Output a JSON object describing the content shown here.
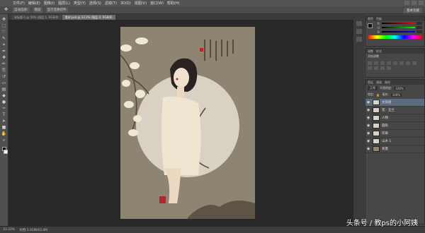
{
  "menu": {
    "items": [
      "文件(F)",
      "编辑(E)",
      "图像(I)",
      "图层(L)",
      "类型(Y)",
      "选择(S)",
      "滤镜(T)",
      "3D(D)",
      "视图(V)",
      "窗口(W)",
      "帮助(H)"
    ]
  },
  "options": {
    "items": [
      "自动选择:",
      "图层",
      "显示变换控件"
    ],
    "workspace": "基本功能"
  },
  "tabs": [
    {
      "label": "未标题-1 @ 50% (图层 1, RGB/8)"
    },
    {
      "label": "素材.psd @ 33.3% (图层 0, RGB/8)"
    }
  ],
  "tools": [
    "move",
    "marquee",
    "lasso",
    "quick-select",
    "crop",
    "eyedropper",
    "heal",
    "brush",
    "clone",
    "history",
    "eraser",
    "gradient",
    "blur",
    "dodge",
    "pen",
    "type",
    "path-select",
    "shape",
    "hand",
    "zoom"
  ],
  "panels": {
    "color_tabs": [
      "颜色",
      "色板"
    ],
    "adjust_tabs": [
      "调整",
      "样式"
    ],
    "adjust_title": "添加调整",
    "layers_tabs": [
      "图层",
      "通道",
      "路径"
    ],
    "blend_mode": "正常",
    "opacity_label": "不透明度:",
    "opacity_value": "100%",
    "fill_label": "填充:",
    "fill_value": "100%",
    "lock_label": "锁定:",
    "layers": [
      {
        "name": "文案组",
        "selected": true
      },
      {
        "name": "花 · 玉兰",
        "selected": false
      },
      {
        "name": "人物",
        "selected": false
      },
      {
        "name": "圆形",
        "selected": false
      },
      {
        "name": "印章",
        "selected": false
      },
      {
        "name": "山水 1",
        "selected": false
      },
      {
        "name": "背景",
        "selected": false
      }
    ]
  },
  "status": {
    "zoom": "33.33%",
    "doc": "文档:1.91M/43.4M"
  },
  "watermark": "头条号 / 教ps的小阿姨",
  "colors": {
    "doc_bg": "#8e8472",
    "circle": "#d9d2c4",
    "dress": "#efe5d0",
    "layer_selected": "#5d6b7f"
  }
}
